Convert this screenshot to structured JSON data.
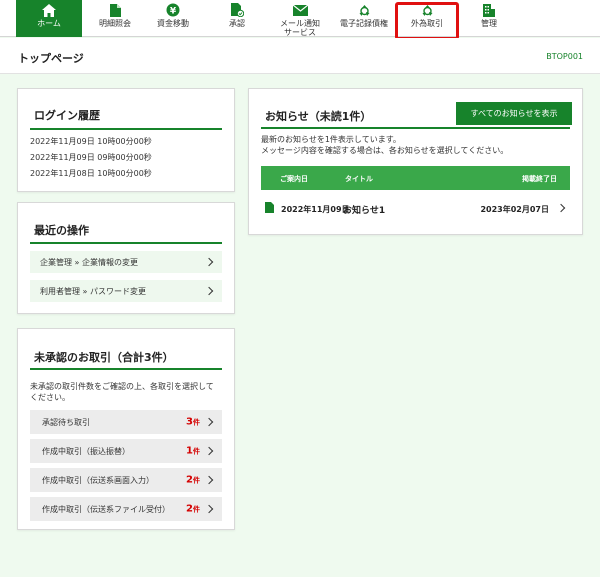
{
  "nav": {
    "items": [
      {
        "label": "ホーム",
        "icon": "home-icon"
      },
      {
        "label": "明細照会",
        "icon": "document-icon"
      },
      {
        "label": "資金移動",
        "icon": "yen-transfer-icon"
      },
      {
        "label": "承認",
        "icon": "approval-doc-icon"
      },
      {
        "label": "メール通知\nサービス",
        "icon": "mail-icon"
      },
      {
        "label": "電子記録債権",
        "icon": "recycle-icon"
      },
      {
        "label": "外為取引",
        "icon": "recycle-icon"
      },
      {
        "label": "管理",
        "icon": "building-icon"
      }
    ],
    "active_index": 0,
    "highlighted_index": 6
  },
  "page": {
    "title": "トップページ",
    "code": "BTOP001"
  },
  "login_history": {
    "title": "ログイン履歴",
    "entries": [
      "2022年11月09日 10時00分00秒",
      "2022年11月09日 09時00分00秒",
      "2022年11月08日 10時00分00秒"
    ]
  },
  "recent_ops": {
    "title": "最近の操作",
    "items": [
      "企業管理 » 企業情報の変更",
      "利用者管理 » パスワード変更"
    ]
  },
  "pending": {
    "title": "未承認のお取引（合計3件）",
    "description": "未承認の取引件数をご確認の上、各取引を選択してください。",
    "unit": "件",
    "items": [
      {
        "label": "承認待ち取引",
        "count": "3"
      },
      {
        "label": "作成中取引（振込振替）",
        "count": "1"
      },
      {
        "label": "作成中取引（伝送系画面入力）",
        "count": "2"
      },
      {
        "label": "作成中取引（伝送系ファイル受付）",
        "count": "2"
      }
    ]
  },
  "notices": {
    "title": "お知らせ（未読1件）",
    "show_all_label": "すべてのお知らせを表示",
    "description": "最新のお知らせを1件表示しています。\nメッセージ内容を確認する場合は、各お知らせを選択してください。",
    "columns": {
      "date": "ご案内日",
      "title": "タイトル",
      "end": "掲載終了日"
    },
    "rows": [
      {
        "date": "2022年11月09日",
        "title": "お知らせ1",
        "end": "2023年02月07日"
      }
    ]
  },
  "colors": {
    "brand_green": "#17832b",
    "table_header_green": "#3aa84a",
    "background": "#effaef",
    "highlight_red": "#e01010",
    "count_red": "#d40000"
  }
}
